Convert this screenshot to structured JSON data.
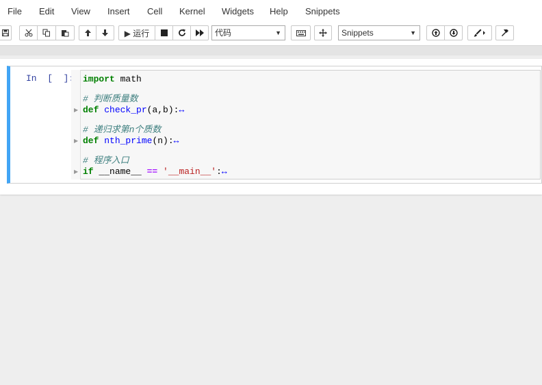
{
  "menu": [
    "File",
    "Edit",
    "View",
    "Insert",
    "Cell",
    "Kernel",
    "Widgets",
    "Help",
    "Snippets"
  ],
  "toolbar": {
    "run_label": "▶ 运行",
    "cell_type": "代码",
    "snippets": "Snippets"
  },
  "cell": {
    "prompt": "In  [  ]:",
    "code": {
      "line1_kw": "import",
      "line1_rest": " math",
      "comment1": "# 判断质量数",
      "def1_kw": "def",
      "def1_name": "check_pr",
      "def1_args": "(a,b):",
      "comment2": "# 递归求第n个质数",
      "def2_kw": "def",
      "def2_name": "nth_prime",
      "def2_args": "(n):",
      "comment3": "# 程序入口",
      "if_kw": "if",
      "if_name": " __name__ ",
      "if_op": "==",
      "if_str": " '__main__'",
      "if_colon": ":",
      "fold": "↔"
    }
  },
  "icons": [
    "save-icon",
    "cut-icon",
    "copy-icon",
    "paste-icon",
    "arrow-up-icon",
    "arrow-down-icon",
    "stop-icon",
    "restart-icon",
    "fast-forward-icon",
    "keyboard-icon",
    "move-icon",
    "arrow-circle-up-icon",
    "arrow-circle-down-icon",
    "paintbrush-icon",
    "hammer-icon"
  ],
  "colors": {
    "cell_border": "#42a5f5",
    "prompt": "#303f9f",
    "keyword": "#008000",
    "comment": "#408080"
  }
}
